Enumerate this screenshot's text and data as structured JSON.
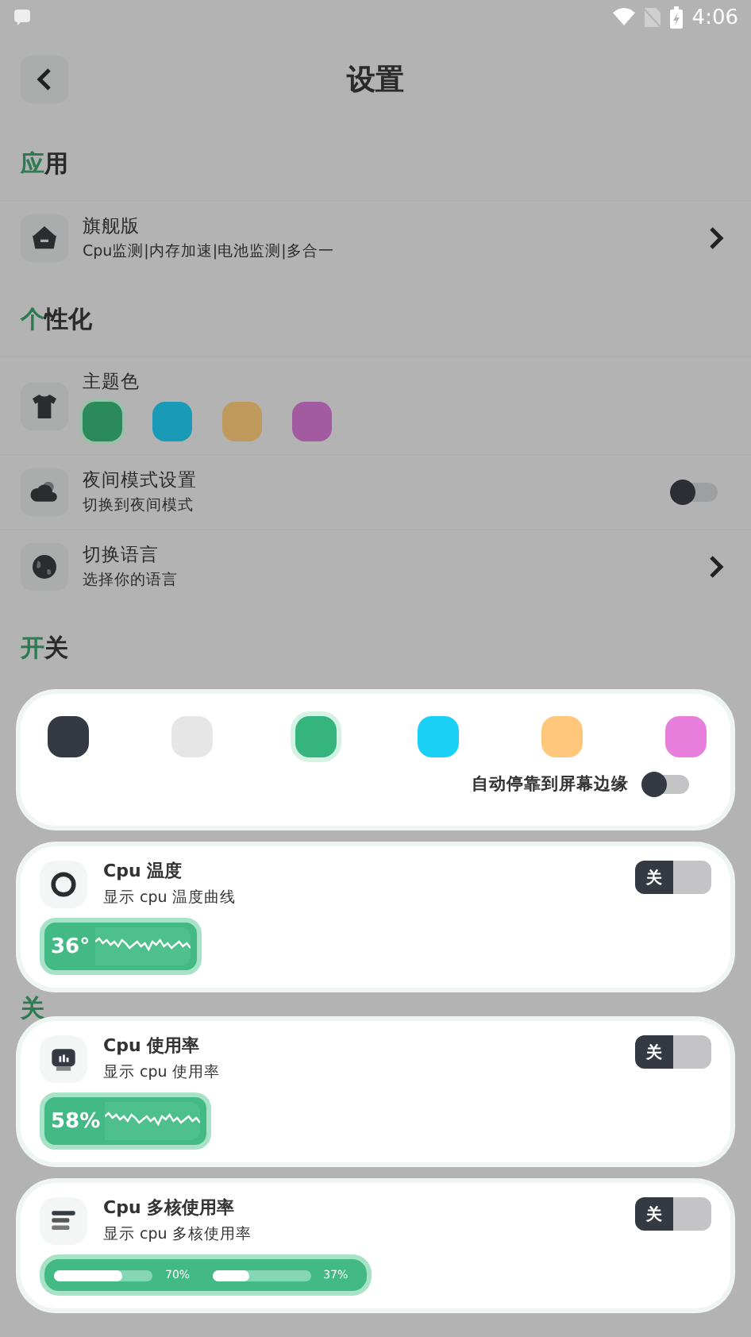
{
  "status_bar": {
    "time": "4:06"
  },
  "header": {
    "title": "设置"
  },
  "sections": [
    {
      "accent": "应",
      "rest": "用",
      "items": [
        {
          "kind": "link",
          "title": "旗舰版",
          "subtitle": "Cpu监测|内存加速|电池监测|多合一"
        }
      ]
    },
    {
      "accent": "个",
      "rest": "性化",
      "items": [
        {
          "kind": "colors",
          "title": "主题色",
          "colors": [
            {
              "color": "#2b8a5c",
              "selected": true
            },
            {
              "color": "#199bb8",
              "selected": false
            },
            {
              "color": "#c09a5c",
              "selected": false
            },
            {
              "color": "#a25aa0",
              "selected": false
            }
          ]
        },
        {
          "kind": "toggle",
          "title": "夜间模式设置",
          "subtitle": "切换到夜间模式",
          "on": false
        },
        {
          "kind": "link",
          "title": "切换语言",
          "subtitle": "选择你的语言"
        }
      ]
    },
    {
      "accent": "开",
      "rest": "关"
    },
    {
      "accent": "关"
    }
  ],
  "floating_panel": {
    "swatches": [
      {
        "color": "#353a42",
        "selected": false
      },
      {
        "color": "#e6e6e6",
        "selected": false
      },
      {
        "color": "#35b57d",
        "selected": true
      },
      {
        "color": "#1ad0f5",
        "selected": false
      },
      {
        "color": "#fec77b",
        "selected": false
      },
      {
        "color": "#e87fdc",
        "selected": false
      }
    ],
    "dock_label": "自动停靠到屏幕边缘",
    "dock_on": false
  },
  "widgets": [
    {
      "kind": "spark",
      "title": "Cpu 温度",
      "subtitle": "显示 cpu 温度曲线",
      "toggle_label": "关",
      "on": false,
      "reading": "36°"
    },
    {
      "kind": "spark",
      "title": "Cpu 使用率",
      "subtitle": "显示 cpu 使用率",
      "toggle_label": "关",
      "on": false,
      "reading": "58%"
    },
    {
      "kind": "cores",
      "title": "Cpu 多核使用率",
      "subtitle": "显示 cpu 多核使用率",
      "toggle_label": "关",
      "on": false,
      "cores": [
        {
          "level": 0.7,
          "reading": "70%"
        },
        {
          "level": 0.37,
          "reading": "37%"
        }
      ]
    }
  ]
}
